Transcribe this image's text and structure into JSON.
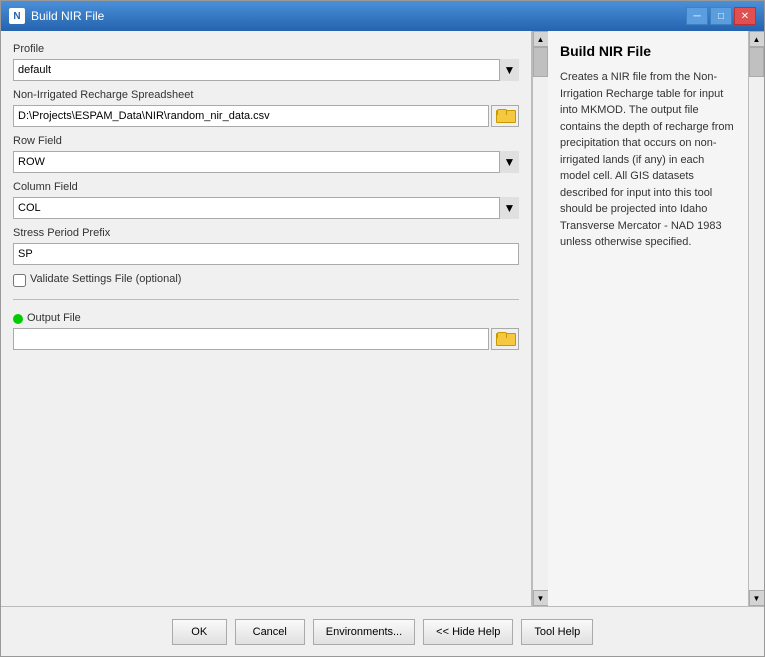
{
  "window": {
    "title": "Build NIR File",
    "icon": "N"
  },
  "titlebar": {
    "minimize_label": "─",
    "maximize_label": "□",
    "close_label": "✕"
  },
  "left_panel": {
    "profile_label": "Profile",
    "profile_value": "default",
    "profile_options": [
      "default"
    ],
    "spreadsheet_label": "Non-Irrigated Recharge Spreadsheet",
    "spreadsheet_value": "D:\\Projects\\ESPAM_Data\\NIR\\random_nir_data.csv",
    "row_field_label": "Row Field",
    "row_field_value": "ROW",
    "row_field_options": [
      "ROW"
    ],
    "column_field_label": "Column Field",
    "column_field_value": "COL",
    "column_field_options": [
      "COL"
    ],
    "stress_period_label": "Stress Period Prefix",
    "stress_period_value": "SP",
    "validate_checkbox_label": "Validate Settings File (optional)",
    "output_file_label": "Output File",
    "output_file_value": ""
  },
  "right_panel": {
    "title": "Build NIR File",
    "description": "Creates a NIR file from the Non-Irrigation Recharge table for input into MKMOD. The output file contains the depth of recharge from precipitation that occurs on non-irrigated lands (if any) in each model cell. All GIS datasets described for input into this tool should be projected into Idaho Transverse Mercator - NAD 1983 unless otherwise specified."
  },
  "footer": {
    "ok_label": "OK",
    "cancel_label": "Cancel",
    "environments_label": "Environments...",
    "hide_help_label": "<< Hide Help",
    "tool_help_label": "Tool Help"
  },
  "icons": {
    "folder": "📁",
    "dropdown_arrow": "▼",
    "scroll_up": "▲",
    "scroll_down": "▼"
  }
}
